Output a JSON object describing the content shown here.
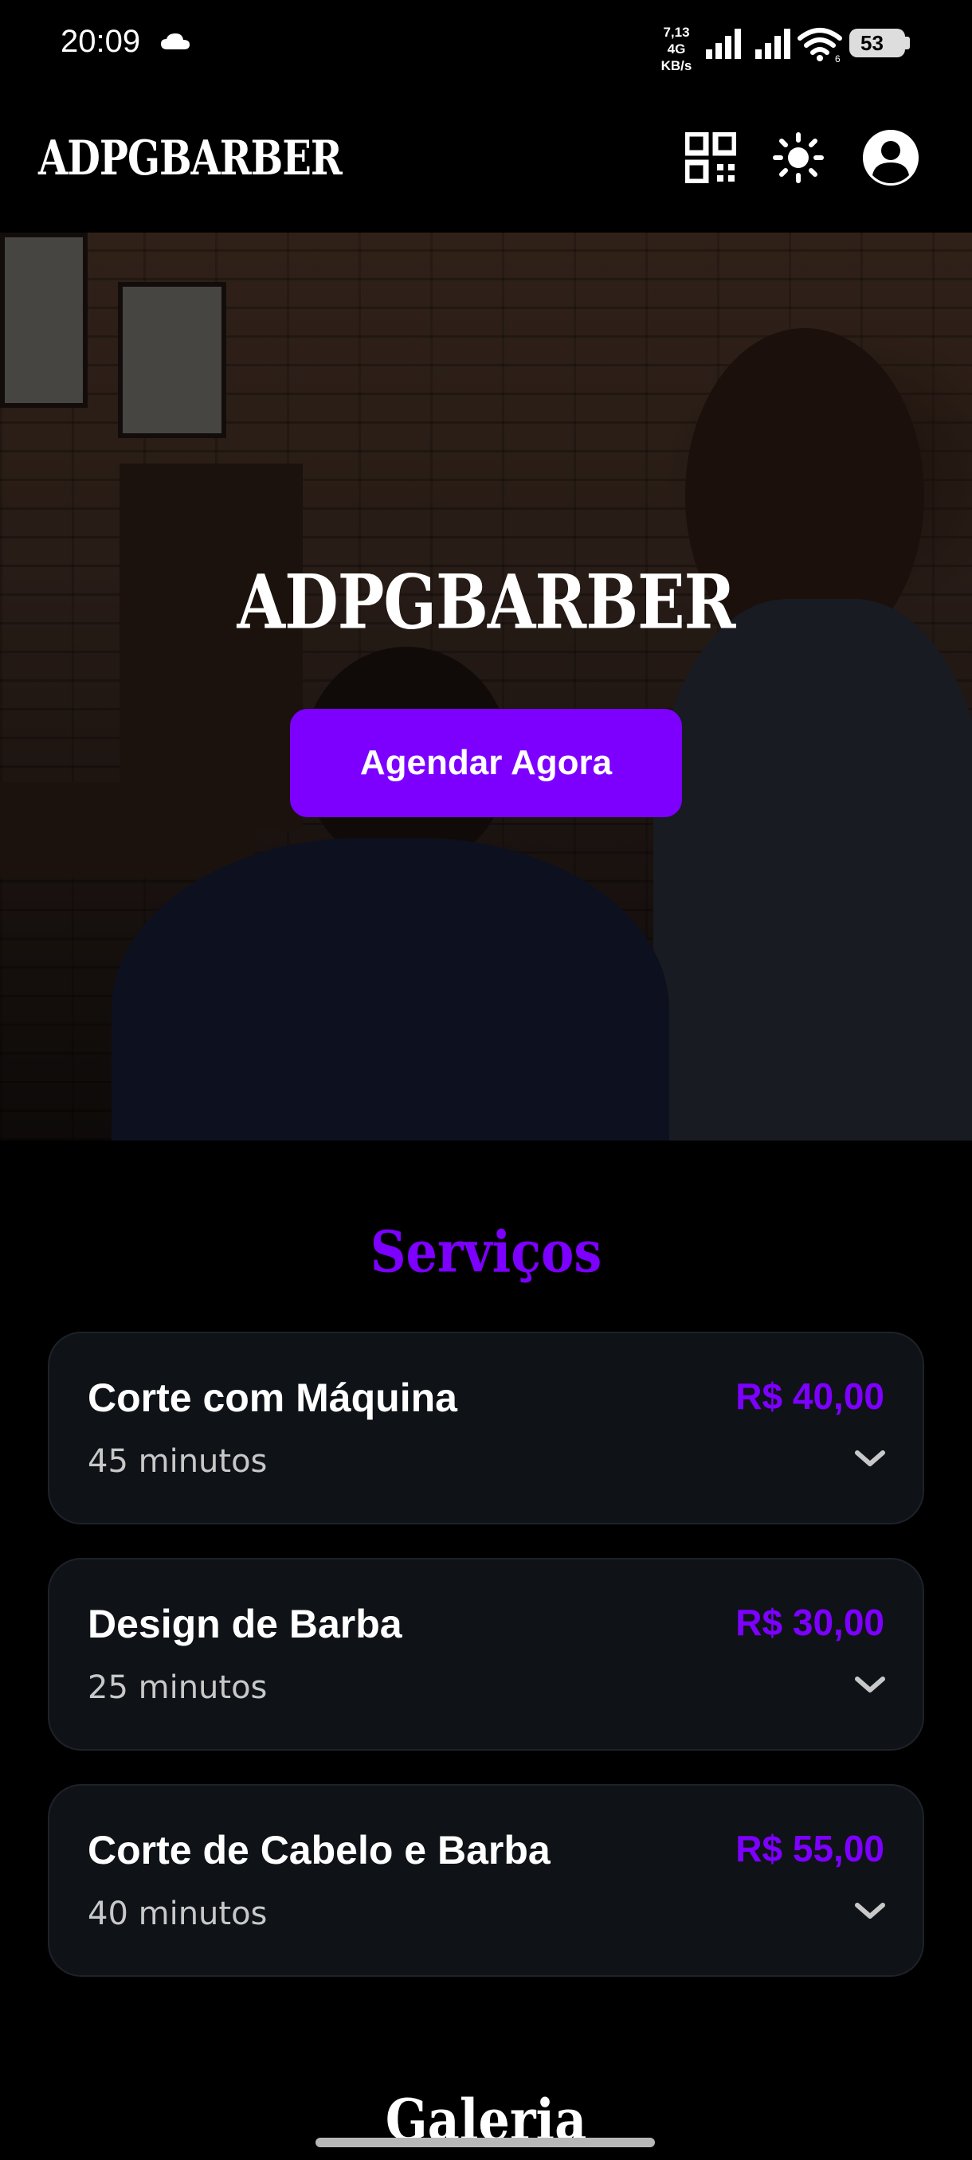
{
  "status_bar": {
    "time": "20:09",
    "net_speed_value": "7,13",
    "net_type": "4G",
    "net_speed_unit": "KB/s",
    "wifi_label": "6",
    "battery": "53"
  },
  "header": {
    "brand": "ADPGBARBER",
    "icons": [
      "qr-code-icon",
      "brightness-icon",
      "account-icon"
    ]
  },
  "hero": {
    "title": "ADPGBARBER",
    "cta_label": "Agendar Agora"
  },
  "services": {
    "title": "Serviços",
    "items": [
      {
        "name": "Corte com Máquina",
        "duration": "45 minutos",
        "price": "R$ 40,00"
      },
      {
        "name": "Design de Barba",
        "duration": "25 minutos",
        "price": "R$ 30,00"
      },
      {
        "name": "Corte de Cabelo e Barba",
        "duration": "40 minutos",
        "price": "R$ 55,00"
      }
    ]
  },
  "gallery": {
    "title": "Galeria"
  },
  "colors": {
    "accent": "#7d00ff",
    "background": "#000000",
    "card": "#0f1318"
  }
}
